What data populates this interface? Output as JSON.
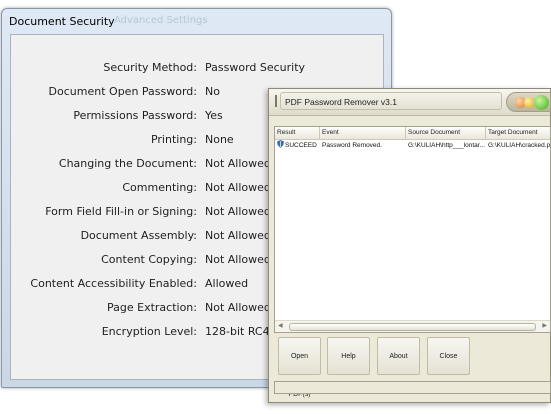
{
  "document_security": {
    "title": "Document Security",
    "title_ghost": "Advanced Settings",
    "fields": [
      {
        "label": "Security Method:",
        "value": "Password Security"
      },
      {
        "label": "Document Open Password:",
        "value": "No"
      },
      {
        "label": "Permissions Password:",
        "value": "Yes"
      },
      {
        "label": "Printing:",
        "value": "None"
      },
      {
        "label": "Changing the Document:",
        "value": "Not Allowed"
      },
      {
        "label": "Commenting:",
        "value": "Not Allowed"
      },
      {
        "label": "Form Field Fill-in or Signing:",
        "value": "Not Allowed"
      },
      {
        "label": "Document Assembly:",
        "value": "Not Allowed"
      },
      {
        "label": "Content Copying:",
        "value": "Not Allowed"
      },
      {
        "label": "Content Accessibility Enabled:",
        "value": "Allowed"
      },
      {
        "label": "Page Extraction:",
        "value": "Not Allowed"
      },
      {
        "label": "Encryption Level:",
        "value": "128-bit RC4"
      }
    ]
  },
  "pdf_remover": {
    "title": "PDF Password Remover v3.1",
    "columns": [
      "Result",
      "Event",
      "Source Document",
      "Target Document"
    ],
    "rows": [
      {
        "result": "SUCCEED",
        "event": "Password Removed.",
        "source": "G:\\KULIAH\\http___lontar...",
        "target": "G:\\KULIAH\\cracked.pdf"
      }
    ],
    "buttons": {
      "open": "Open PDF(s)",
      "help": "Help",
      "about": "About",
      "close": "Close"
    },
    "colors": {
      "success_icon": "#2c6fc4",
      "close_orb": "#42a818"
    }
  }
}
